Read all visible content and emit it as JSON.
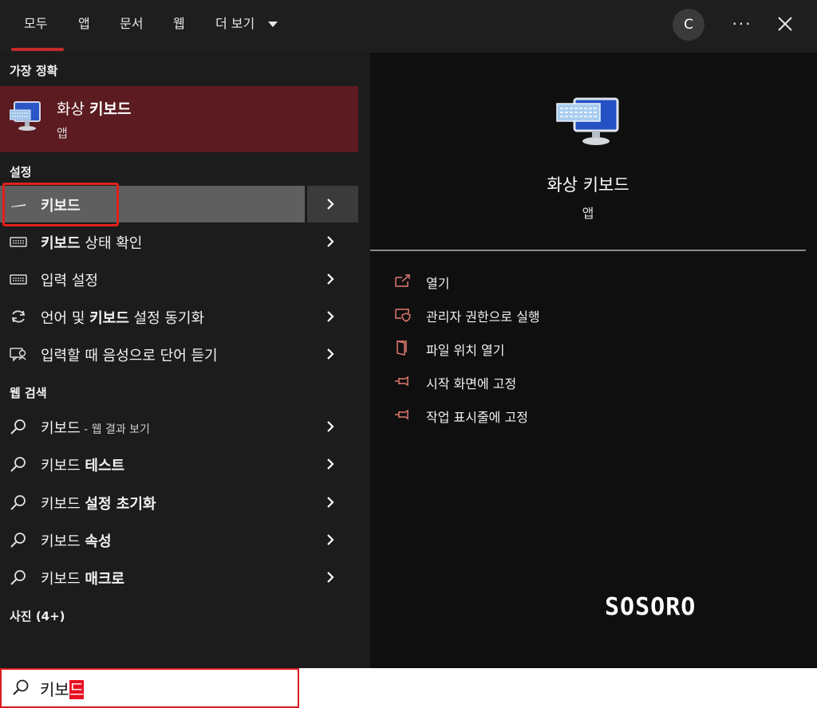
{
  "tabs": [
    {
      "label": "모두"
    },
    {
      "label": "앱"
    },
    {
      "label": "문서"
    },
    {
      "label": "웹"
    },
    {
      "label": "더 보기"
    }
  ],
  "account": {
    "initial": "C"
  },
  "left": {
    "best_match_heading": "가장 정확",
    "best_match": {
      "title_plain": "화상 ",
      "title_bold": "키보드",
      "subtitle": "앱"
    },
    "settings_heading": "설정",
    "settings_items": [
      {
        "bold": "키보드",
        "rest": ""
      },
      {
        "bold": "키보드",
        "rest": " 상태 확인"
      },
      {
        "pre": "입력 설정"
      },
      {
        "pre": "언어 및 ",
        "bold": "키보드",
        "rest": " 설정 동기화"
      },
      {
        "pre": "입력할 때 음성으로 단어 듣기"
      }
    ],
    "web_heading": "웹 검색",
    "web_items": [
      {
        "text": "키보드",
        "note": " - 웹 결과 보기"
      },
      {
        "text": "키보드 ",
        "bold": "테스트"
      },
      {
        "text": "키보드 ",
        "bold": "설정 초기화"
      },
      {
        "text": "키보드 ",
        "bold": "속성"
      },
      {
        "text": "키보드 ",
        "bold": "매크로"
      }
    ],
    "photos_heading": "사진 (4+)"
  },
  "preview": {
    "title": "화상 키보드",
    "subtitle": "앱",
    "actions": [
      {
        "label": "열기"
      },
      {
        "label": "관리자 권한으로 실행"
      },
      {
        "label": "파일 위치 열기"
      },
      {
        "label": "시작 화면에 고정"
      },
      {
        "label": "작업 표시줄에 고정"
      }
    ]
  },
  "watermark": "SOSORO",
  "search": {
    "typed": "키보",
    "selected": "드"
  },
  "colors": {
    "accent": "#c42b2b",
    "best_match_bg": "#5c1b21",
    "action_icon": "#e07a70",
    "highlight_border": "#e0201c"
  }
}
